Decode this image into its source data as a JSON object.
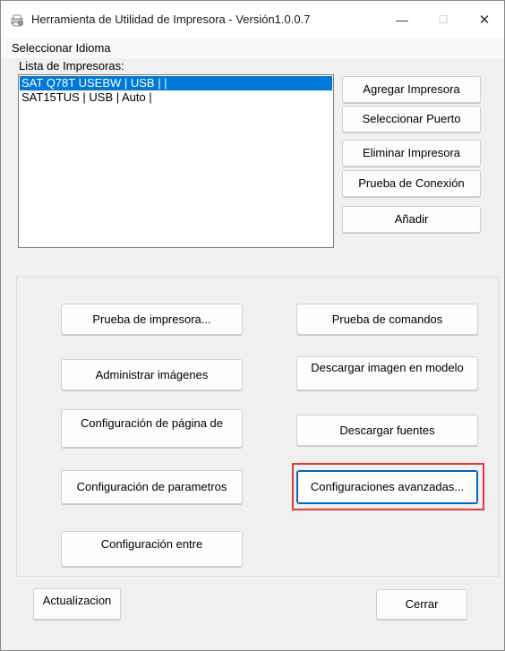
{
  "window": {
    "title": "Herramienta de Utilidad de Impresora - Versión1.0.0.7",
    "icon": "printer-gear-icon",
    "controls": {
      "minimize": "—",
      "maximize": "☐",
      "close": "✕"
    }
  },
  "menu": {
    "select_language": "Seleccionar Idioma"
  },
  "printers": {
    "label": "Lista de Impresoras:",
    "items": [
      {
        "text": "SAT Q78T USEBW | USB |  |",
        "selected": true
      },
      {
        "text": "SAT15TUS | USB | Auto |",
        "selected": false
      }
    ]
  },
  "right_buttons": {
    "add_printer": "Agregar Impresora",
    "select_port": "Seleccionar Puerto",
    "delete_printer": "Eliminar Impresora",
    "connection_test": "Prueba de Conexión",
    "add": "Añadir"
  },
  "tools": {
    "printer_test": "Prueba de impresora...",
    "command_test": "Prueba de comandos",
    "manage_images": "Administrar imágenes",
    "download_image": "Descargar imagen en modelo",
    "page_config": "Configuración de página de",
    "download_fonts": "Descargar fuentes",
    "param_config": "Configuración de parametros",
    "advanced_config": "Configuraciones avanzadas...",
    "config_between": "Configuración entre"
  },
  "footer": {
    "update": "Actualizacion",
    "close": "Cerrar"
  },
  "colors": {
    "selection": "#0078d7",
    "highlight_border": "#e53935",
    "focus_border": "#0067c0"
  }
}
